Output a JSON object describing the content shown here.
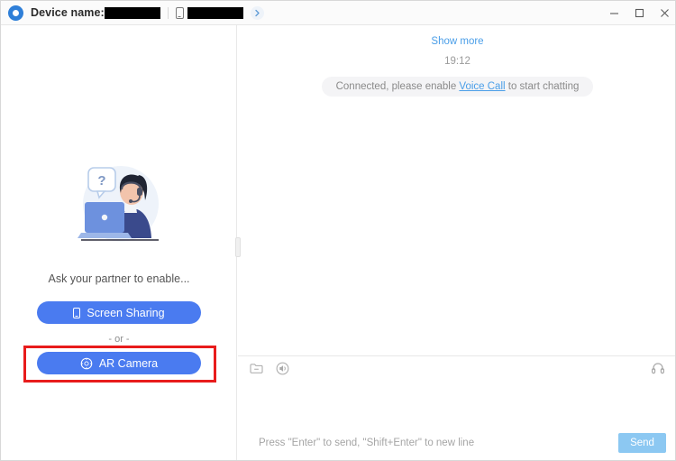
{
  "window": {
    "logo_icon": "app-logo-icon",
    "device_label": "Device name:",
    "device_name_redacted": "",
    "connected_device_redacted": "",
    "phone_icon": "phone-icon",
    "expand_icon": "chevron-right-icon",
    "minimize": "–",
    "maximize": "□",
    "close": "✕"
  },
  "left_panel": {
    "illustration": "support-agent-illustration",
    "hint": "Ask your partner to enable...",
    "screen_sharing_button": "Screen Sharing",
    "screen_sharing_icon": "phone-icon",
    "or_separator": "- or -",
    "ar_camera_button": "AR Camera",
    "ar_camera_icon": "ar-camera-icon",
    "highlight_color": "#e81c1c",
    "button_color": "#4a7bf0"
  },
  "chat": {
    "show_more": "Show more",
    "timestamp": "19:12",
    "system_message_prefix": "Connected, please enable ",
    "system_message_link": "Voice Call",
    "system_message_suffix": " to start chatting",
    "link_color": "#4a9ee8"
  },
  "composer": {
    "file_icon": "folder-file-icon",
    "voice_icon": "voice-message-icon",
    "headset_icon": "headset-icon",
    "input_value": "",
    "input_placeholder": "",
    "send_hint": "Press \"Enter\" to send, \"Shift+Enter\" to new line",
    "send_label": "Send",
    "send_color": "#8cc8f2"
  }
}
